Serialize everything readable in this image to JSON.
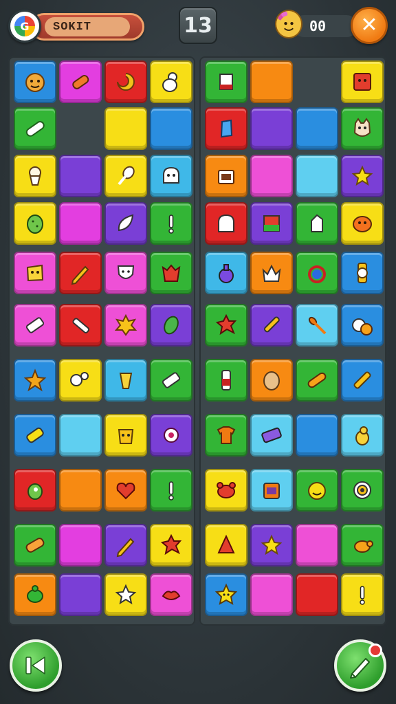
{
  "header": {
    "player_name": "SOKIT",
    "level": "13",
    "score": "00"
  },
  "colors": {
    "blue": "#2a8ee0",
    "purple": "#7a3fd6",
    "red": "#e12626",
    "yellow": "#f7de16",
    "green": "#33b536",
    "orange": "#f78a12",
    "cyan": "#3fb8e8",
    "magenta": "#e33ee0",
    "pink": "#ee50d6",
    "light": "#5fcff0",
    "empty": "transparent"
  },
  "board": {
    "rows": [
      [
        {
          "color": "blue",
          "icon": "face-icon"
        },
        {
          "color": "magenta",
          "icon": "crayon-icon"
        },
        {
          "color": "red",
          "icon": "swirl-icon"
        },
        {
          "color": "yellow",
          "icon": "bowling-pin-icon"
        },
        {
          "color": "green",
          "icon": "card-icon"
        },
        {
          "color": "orange",
          "icon": ""
        },
        {
          "color": "empty",
          "icon": ""
        },
        {
          "color": "yellow",
          "icon": "box-face-icon"
        }
      ],
      [
        {
          "color": "green",
          "icon": "pill-icon"
        },
        {
          "color": "empty",
          "icon": ""
        },
        {
          "color": "yellow",
          "icon": ""
        },
        {
          "color": "blue",
          "icon": ""
        },
        {
          "color": "red",
          "icon": "gem-icon"
        },
        {
          "color": "purple",
          "icon": ""
        },
        {
          "color": "blue",
          "icon": ""
        },
        {
          "color": "green",
          "icon": "cat-icon"
        }
      ],
      [
        {
          "color": "yellow",
          "icon": "ice-cream-icon"
        },
        {
          "color": "purple",
          "icon": ""
        },
        {
          "color": "yellow",
          "icon": "drumstick-icon"
        },
        {
          "color": "cyan",
          "icon": "ghost-icon"
        },
        {
          "color": "orange",
          "icon": "chest-icon"
        },
        {
          "color": "pink",
          "icon": ""
        },
        {
          "color": "light",
          "icon": ""
        },
        {
          "color": "purple",
          "icon": "star-icon"
        }
      ],
      [
        {
          "color": "yellow",
          "icon": "egg-icon"
        },
        {
          "color": "magenta",
          "icon": ""
        },
        {
          "color": "purple",
          "icon": "leaf-icon"
        },
        {
          "color": "green",
          "icon": "exclaim-icon"
        },
        {
          "color": "red",
          "icon": "arch-icon"
        },
        {
          "color": "purple",
          "icon": "block-icon"
        },
        {
          "color": "green",
          "icon": "hand-icon"
        },
        {
          "color": "yellow",
          "icon": "blob-icon"
        }
      ],
      [
        {
          "color": "pink",
          "icon": "sponge-icon"
        },
        {
          "color": "red",
          "icon": "pencil-icon"
        },
        {
          "color": "pink",
          "icon": "shield-face-icon"
        },
        {
          "color": "green",
          "icon": "monster-icon"
        },
        {
          "color": "cyan",
          "icon": "potion-icon"
        },
        {
          "color": "orange",
          "icon": "crown-icon"
        },
        {
          "color": "green",
          "icon": "ring-icon"
        },
        {
          "color": "blue",
          "icon": "watch-icon"
        }
      ],
      [
        {
          "color": "pink",
          "icon": "eraser-icon"
        },
        {
          "color": "red",
          "icon": "stick-icon"
        },
        {
          "color": "pink",
          "icon": "sun-face-icon"
        },
        {
          "color": "purple",
          "icon": "leaf-green-icon"
        },
        {
          "color": "green",
          "icon": "splat-icon"
        },
        {
          "color": "purple",
          "icon": "brush-icon"
        },
        {
          "color": "light",
          "icon": "spoon-icon"
        },
        {
          "color": "blue",
          "icon": "moon-icon"
        }
      ],
      [
        {
          "color": "blue",
          "icon": "starfish-icon"
        },
        {
          "color": "yellow",
          "icon": "bone-icon"
        },
        {
          "color": "cyan",
          "icon": "corn-icon"
        },
        {
          "color": "green",
          "icon": "eraser-icon"
        },
        {
          "color": "green",
          "icon": "battery-icon"
        },
        {
          "color": "orange",
          "icon": "potato-icon"
        },
        {
          "color": "green",
          "icon": "carrot-icon"
        },
        {
          "color": "blue",
          "icon": "crayon-yellow-icon"
        }
      ],
      [
        {
          "color": "blue",
          "icon": "can-icon"
        },
        {
          "color": "light",
          "icon": ""
        },
        {
          "color": "yellow",
          "icon": "giraffe-icon"
        },
        {
          "color": "purple",
          "icon": "virus-icon"
        },
        {
          "color": "green",
          "icon": "shirt-icon"
        },
        {
          "color": "light",
          "icon": "gift-icon"
        },
        {
          "color": "blue",
          "icon": ""
        },
        {
          "color": "light",
          "icon": "pear-icon"
        }
      ],
      [
        {
          "color": "red",
          "icon": "bird-icon"
        },
        {
          "color": "orange",
          "icon": ""
        },
        {
          "color": "orange",
          "icon": "heart-icon"
        },
        {
          "color": "green",
          "icon": "exclaim-icon"
        },
        {
          "color": "yellow",
          "icon": "crab-icon"
        },
        {
          "color": "light",
          "icon": "toaster-icon"
        },
        {
          "color": "green",
          "icon": "smile-icon"
        },
        {
          "color": "green",
          "icon": "target-icon"
        }
      ],
      [
        {
          "color": "green",
          "icon": "bandage-icon"
        },
        {
          "color": "magenta",
          "icon": ""
        },
        {
          "color": "purple",
          "icon": "pencil-icon"
        },
        {
          "color": "yellow",
          "icon": "splat-icon"
        },
        {
          "color": "yellow",
          "icon": "cone-icon"
        },
        {
          "color": "purple",
          "icon": "star-icon"
        },
        {
          "color": "pink",
          "icon": ""
        },
        {
          "color": "green",
          "icon": "turtle-icon"
        }
      ],
      [
        {
          "color": "orange",
          "icon": "turtle-green-icon"
        },
        {
          "color": "purple",
          "icon": ""
        },
        {
          "color": "yellow",
          "icon": "white-star-icon"
        },
        {
          "color": "pink",
          "icon": "lips-icon"
        },
        {
          "color": "blue",
          "icon": "star-face-icon"
        },
        {
          "color": "pink",
          "icon": ""
        },
        {
          "color": "red",
          "icon": ""
        },
        {
          "color": "yellow",
          "icon": "exclaim-icon"
        }
      ]
    ]
  },
  "footer": {
    "back_icon": "skip-back-icon",
    "hint_icon": "pencil-icon"
  }
}
